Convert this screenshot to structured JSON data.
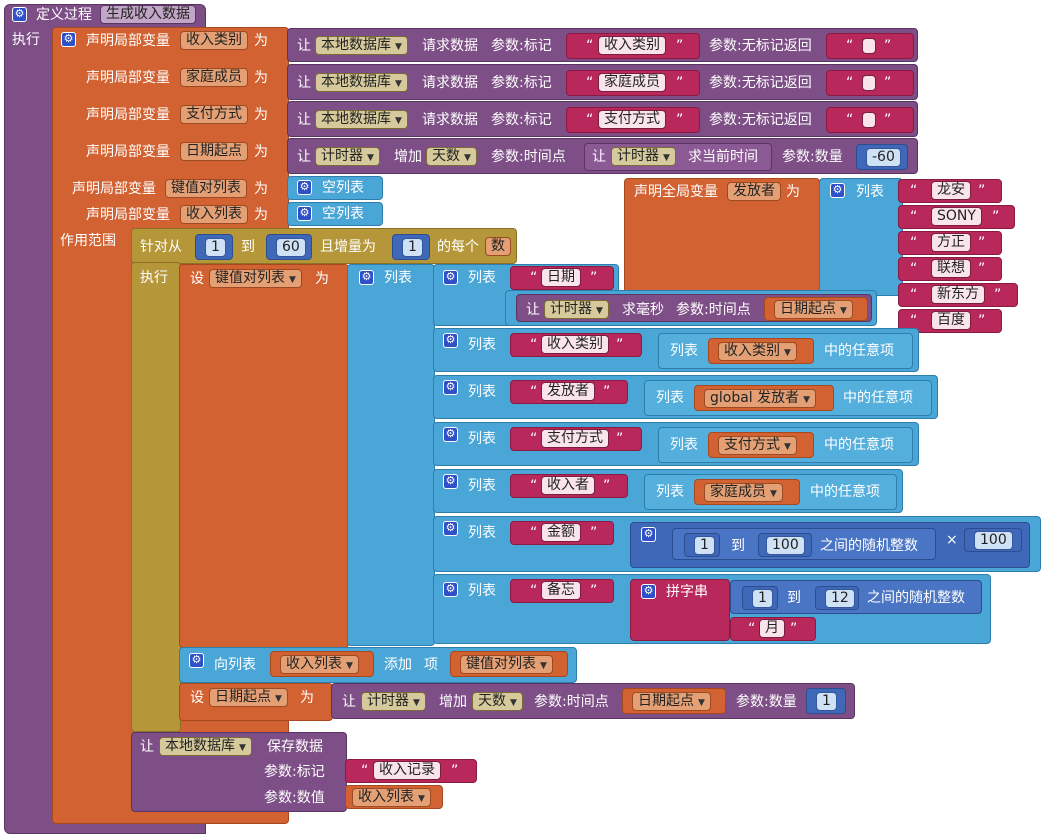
{
  "procedure": {
    "define_label": "定义过程",
    "name": "生成收入数据",
    "do_label": "执行"
  },
  "common": {
    "declare_local": "声明局部变量",
    "as": "为",
    "let": "让",
    "list": "列表",
    "empty_list": "空列表",
    "scope": "作用范围",
    "execute": "执行",
    "set": "设",
    "quote_open": "“",
    "quote_close": "”"
  },
  "locals": [
    {
      "name": "收入类别",
      "db": "本地数据库",
      "request": "请求数据",
      "tag_label": "参数:标记",
      "tag": "收入类别",
      "nomark": "参数:无标记返回",
      "default": ""
    },
    {
      "name": "家庭成员",
      "db": "本地数据库",
      "request": "请求数据",
      "tag_label": "参数:标记",
      "tag": "家庭成员",
      "nomark": "参数:无标记返回",
      "default": ""
    },
    {
      "name": "支付方式",
      "db": "本地数据库",
      "request": "请求数据",
      "tag_label": "参数:标记",
      "tag": "支付方式",
      "nomark": "参数:无标记返回",
      "default": ""
    }
  ],
  "date_start": {
    "name": "日期起点",
    "timer": "计时器",
    "increase": "增加",
    "unit": "天数",
    "timepoint_label": "参数:时间点",
    "let2": "让",
    "timer2": "计时器",
    "now": "求当前时间",
    "count_label": "参数:数量",
    "count": "-60"
  },
  "kv_list": {
    "name": "键值对列表"
  },
  "income_list": {
    "name": "收入列表"
  },
  "global_var": {
    "declare": "声明全局变量",
    "name": "发放者",
    "as": "为",
    "list": "列表",
    "items": [
      "龙安",
      "SONY",
      "方正",
      "联想",
      "新东方",
      "百度"
    ]
  },
  "loop": {
    "for_from": "针对从",
    "from": "1",
    "to_label": "到",
    "to": "60",
    "step_label": "且增量为",
    "step": "1",
    "each_label": "的每个",
    "var": "数"
  },
  "pairs": [
    {
      "key": "日期",
      "timer": "计时器",
      "millis": "求毫秒",
      "timepoint_label": "参数:时间点",
      "arg": "日期起点"
    },
    {
      "key": "收入类别",
      "list_label": "列表",
      "src": "收入类别",
      "pick": "中的任意项"
    },
    {
      "key": "发放者",
      "list_label": "列表",
      "src": "global 发放者",
      "pick": "中的任意项"
    },
    {
      "key": "支付方式",
      "list_label": "列表",
      "src": "支付方式",
      "pick": "中的任意项"
    },
    {
      "key": "收入者",
      "list_label": "列表",
      "src": "家庭成员",
      "pick": "中的任意项"
    },
    {
      "key": "金额",
      "from": "1",
      "to_label": "到",
      "to": "100",
      "rand": "之间的随机整数",
      "times": "×",
      "mult": "100"
    },
    {
      "key": "备忘",
      "join": "拼字串",
      "from": "1",
      "to_label": "到",
      "to": "12",
      "rand": "之间的随机整数",
      "suffix": "月"
    }
  ],
  "add_item": {
    "to_list": "向列表",
    "list": "收入列表",
    "add": "添加",
    "item_label": "项",
    "item": "键值对列表"
  },
  "set_date": {
    "set": "设",
    "var": "日期起点",
    "as": "为",
    "let": "让",
    "timer": "计时器",
    "increase": "增加",
    "unit": "天数",
    "timepoint_label": "参数:时间点",
    "arg": "日期起点",
    "count_label": "参数:数量",
    "count": "1"
  },
  "save": {
    "let": "让",
    "db": "本地数据库",
    "action": "保存数据",
    "tag_label": "参数:标记",
    "tag": "收入记录",
    "value_label": "参数:数值",
    "value": "收入列表"
  }
}
